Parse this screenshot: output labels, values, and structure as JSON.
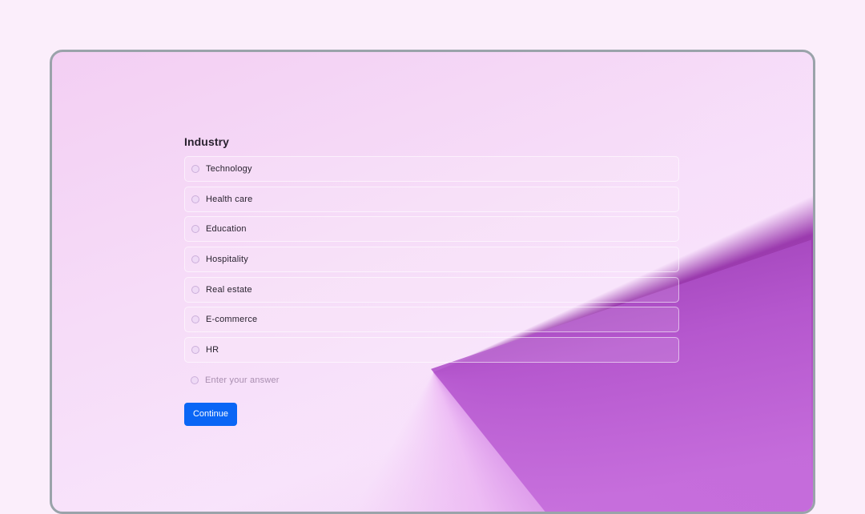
{
  "question": {
    "title": "Industry",
    "options": [
      {
        "label": "Technology"
      },
      {
        "label": "Health care"
      },
      {
        "label": "Education"
      },
      {
        "label": "Hospitality"
      },
      {
        "label": "Real estate"
      },
      {
        "label": "E-commerce"
      },
      {
        "label": "HR"
      }
    ],
    "other_placeholder": "Enter your answer",
    "continue_label": "Continue"
  },
  "colors": {
    "accent": "#0a66f5",
    "background": "#fbeefb",
    "frame_border": "#9aa3aa",
    "wedge": "#b050c8"
  }
}
